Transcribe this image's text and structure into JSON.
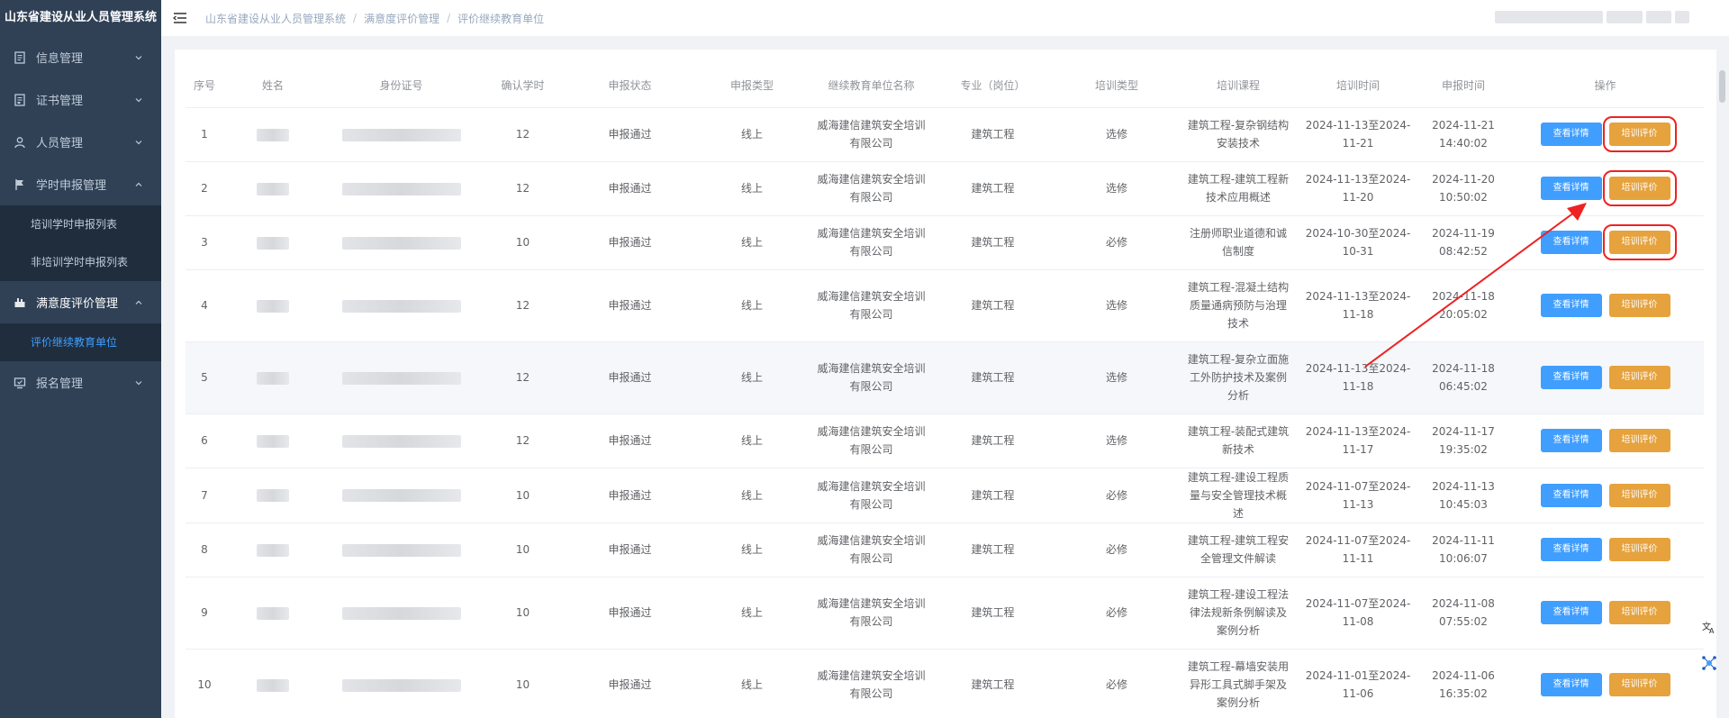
{
  "app": {
    "title": "山东省建设从业人员管理系统"
  },
  "sidebar": {
    "items": [
      {
        "label": "信息管理",
        "icon": "document-icon"
      },
      {
        "label": "证书管理",
        "icon": "certificate-icon"
      },
      {
        "label": "人员管理",
        "icon": "user-icon"
      },
      {
        "label": "学时申报管理",
        "icon": "flag-icon"
      },
      {
        "label": "满意度评价管理",
        "icon": "rating-icon"
      },
      {
        "label": "报名管理",
        "icon": "register-icon"
      }
    ],
    "sub_hours": [
      {
        "label": "培训学时申报列表"
      },
      {
        "label": "非培训学时申报列表"
      }
    ],
    "sub_satisfaction": [
      {
        "label": "评价继续教育单位"
      }
    ]
  },
  "breadcrumb": {
    "items": [
      "山东省建设从业人员管理系统",
      "满意度评价管理",
      "评价继续教育单位"
    ],
    "separator": "/"
  },
  "table": {
    "headers": [
      "序号",
      "姓名",
      "身份证号",
      "确认学时",
      "申报状态",
      "申报类型",
      "继续教育单位名称",
      "专业（岗位）",
      "培训类型",
      "培训课程",
      "培训时间",
      "申报时间",
      "操作"
    ],
    "view_label": "查看详情",
    "eval_label": "培训评价",
    "rows": [
      {
        "no": "1",
        "hours": "12",
        "status": "申报通过",
        "mode": "线上",
        "org": "威海建信建筑安全培训有限公司",
        "major": "建筑工程",
        "ttype": "选修",
        "course": "建筑工程-复杂钢结构安装技术",
        "period": "2024-11-13至2024-11-21",
        "date": "2024-11-21",
        "time": "14:40:02"
      },
      {
        "no": "2",
        "hours": "12",
        "status": "申报通过",
        "mode": "线上",
        "org": "威海建信建筑安全培训有限公司",
        "major": "建筑工程",
        "ttype": "选修",
        "course": "建筑工程-建筑工程新技术应用概述",
        "period": "2024-11-13至2024-11-20",
        "date": "2024-11-20",
        "time": "10:50:02"
      },
      {
        "no": "3",
        "hours": "10",
        "status": "申报通过",
        "mode": "线上",
        "org": "威海建信建筑安全培训有限公司",
        "major": "建筑工程",
        "ttype": "必修",
        "course": "注册师职业道德和诚信制度",
        "period": "2024-10-30至2024-10-31",
        "date": "2024-11-19",
        "time": "08:42:52"
      },
      {
        "no": "4",
        "hours": "12",
        "status": "申报通过",
        "mode": "线上",
        "org": "威海建信建筑安全培训有限公司",
        "major": "建筑工程",
        "ttype": "选修",
        "course": "建筑工程-混凝土结构质量通病预防与治理技术",
        "period": "2024-11-13至2024-11-18",
        "date": "2024-11-18",
        "time": "20:05:02"
      },
      {
        "no": "5",
        "hours": "12",
        "status": "申报通过",
        "mode": "线上",
        "org": "威海建信建筑安全培训有限公司",
        "major": "建筑工程",
        "ttype": "选修",
        "course": "建筑工程-复杂立面施工外防护技术及案例分析",
        "period": "2024-11-13至2024-11-18",
        "date": "2024-11-18",
        "time": "06:45:02"
      },
      {
        "no": "6",
        "hours": "12",
        "status": "申报通过",
        "mode": "线上",
        "org": "威海建信建筑安全培训有限公司",
        "major": "建筑工程",
        "ttype": "选修",
        "course": "建筑工程-装配式建筑新技术",
        "period": "2024-11-13至2024-11-17",
        "date": "2024-11-17",
        "time": "19:35:02"
      },
      {
        "no": "7",
        "hours": "10",
        "status": "申报通过",
        "mode": "线上",
        "org": "威海建信建筑安全培训有限公司",
        "major": "建筑工程",
        "ttype": "必修",
        "course": "建筑工程-建设工程质量与安全管理技术概述",
        "period": "2024-11-07至2024-11-13",
        "date": "2024-11-13",
        "time": "10:45:03"
      },
      {
        "no": "8",
        "hours": "10",
        "status": "申报通过",
        "mode": "线上",
        "org": "威海建信建筑安全培训有限公司",
        "major": "建筑工程",
        "ttype": "必修",
        "course": "建筑工程-建筑工程安全管理文件解读",
        "period": "2024-11-07至2024-11-11",
        "date": "2024-11-11",
        "time": "10:06:07"
      },
      {
        "no": "9",
        "hours": "10",
        "status": "申报通过",
        "mode": "线上",
        "org": "威海建信建筑安全培训有限公司",
        "major": "建筑工程",
        "ttype": "必修",
        "course": "建筑工程-建设工程法律法规新条例解读及案例分析",
        "period": "2024-11-07至2024-11-08",
        "date": "2024-11-08",
        "time": "07:55:02"
      },
      {
        "no": "10",
        "hours": "10",
        "status": "申报通过",
        "mode": "线上",
        "org": "威海建信建筑安全培训有限公司",
        "major": "建筑工程",
        "ttype": "必修",
        "course": "建筑工程-幕墙安装用异形工具式脚手架及案例分析",
        "period": "2024-11-01至2024-11-06",
        "date": "2024-11-06",
        "time": "16:35:02"
      }
    ]
  },
  "colors": {
    "primary": "#409eff",
    "warning": "#e6a23c",
    "sidebar_bg": "#304156",
    "annotation": "#e22222"
  }
}
